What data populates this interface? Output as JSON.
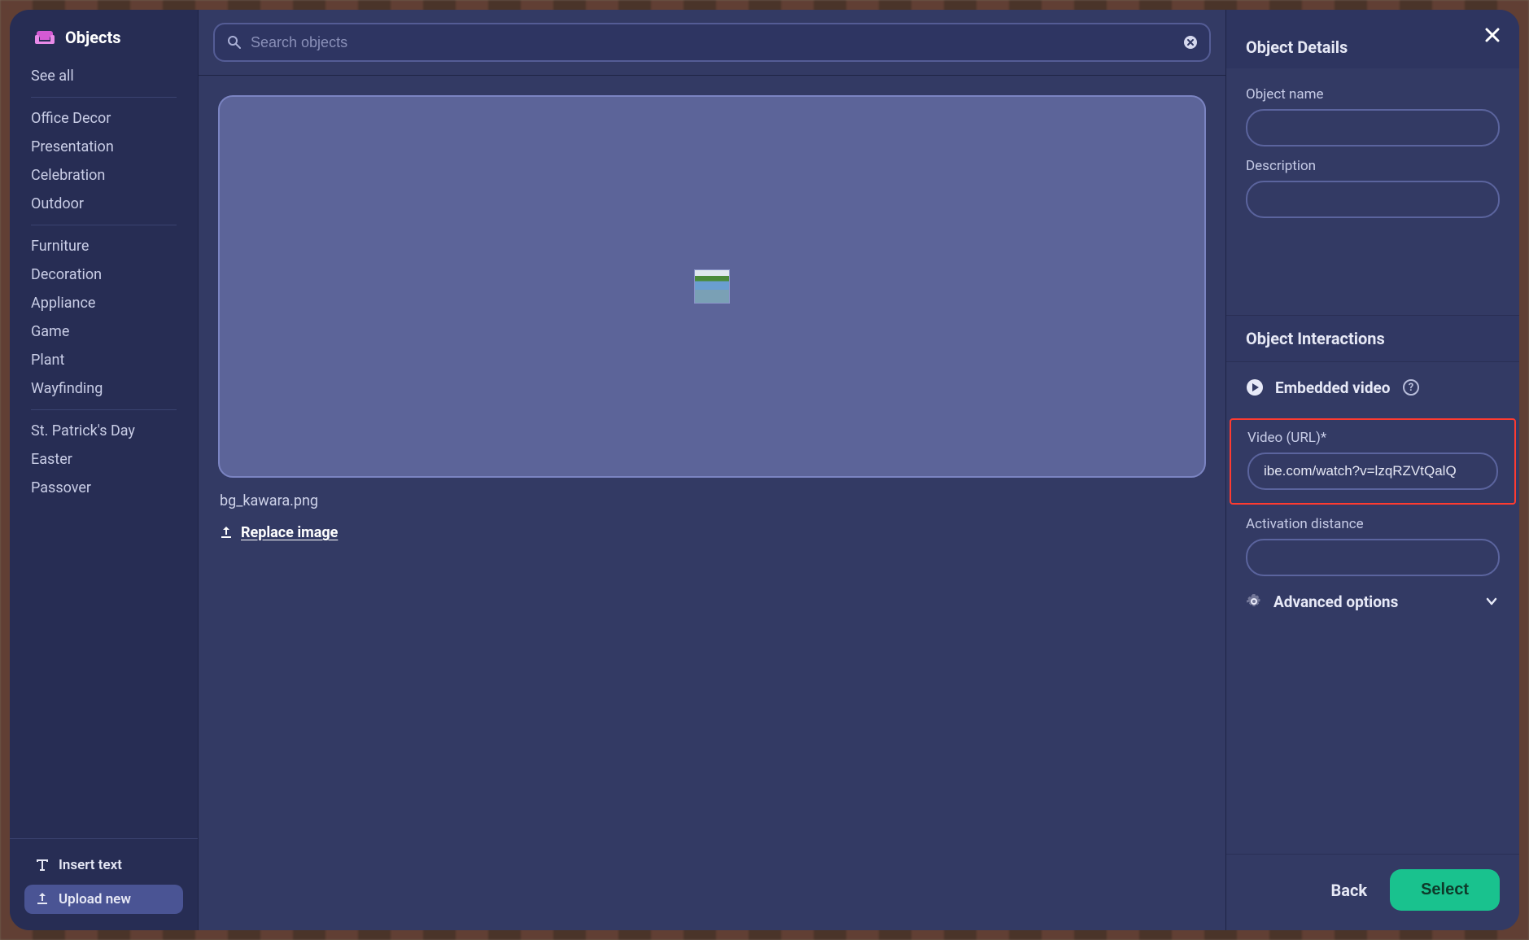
{
  "sidebar": {
    "title": "Objects",
    "groups": [
      [
        "See all"
      ],
      [
        "Office Decor",
        "Presentation",
        "Celebration",
        "Outdoor"
      ],
      [
        "Furniture",
        "Decoration",
        "Appliance",
        "Game",
        "Plant",
        "Wayfinding"
      ],
      [
        "St. Patrick's Day",
        "Easter",
        "Passover"
      ]
    ],
    "insert_text_label": "Insert text",
    "upload_new_label": "Upload new"
  },
  "search": {
    "placeholder": "Search objects"
  },
  "preview": {
    "filename": "bg_kawara.png",
    "replace_label": "Replace image"
  },
  "details": {
    "heading": "Object Details",
    "name_label": "Object name",
    "name_value": "",
    "desc_label": "Description",
    "desc_value": "",
    "interactions_heading": "Object Interactions",
    "embedded_video_label": "Embedded video",
    "video_url_label": "Video (URL)*",
    "video_url_value": "ibe.com/watch?v=lzqRZVtQalQ",
    "activation_label": "Activation distance",
    "activation_value": "",
    "advanced_label": "Advanced options"
  },
  "footer": {
    "back_label": "Back",
    "select_label": "Select"
  }
}
